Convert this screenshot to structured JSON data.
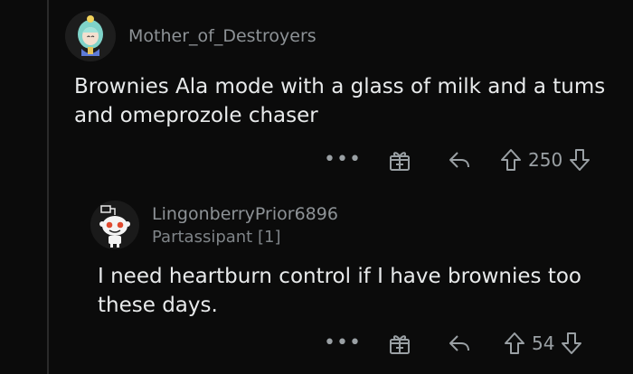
{
  "comments": [
    {
      "username": "Mother_of_Destroyers",
      "flair": "",
      "body_lines": [
        "Brownies Ala mode with a glass of milk and a tums",
        "and omeprozole chaser"
      ],
      "score": "250",
      "avatar_icon": "fantasy-character-avatar-icon"
    },
    {
      "username": "LingonberryPrior6896",
      "flair": "Partassipant [1]",
      "body_lines": [
        "I need heartburn control if I have brownies too",
        "these days."
      ],
      "score": "54",
      "avatar_icon": "snoo-robot-avatar-icon"
    }
  ],
  "actions": {
    "more_label": "•••",
    "icons": [
      "more-options-icon",
      "award-icon",
      "reply-icon",
      "upvote-icon",
      "downvote-icon"
    ]
  }
}
